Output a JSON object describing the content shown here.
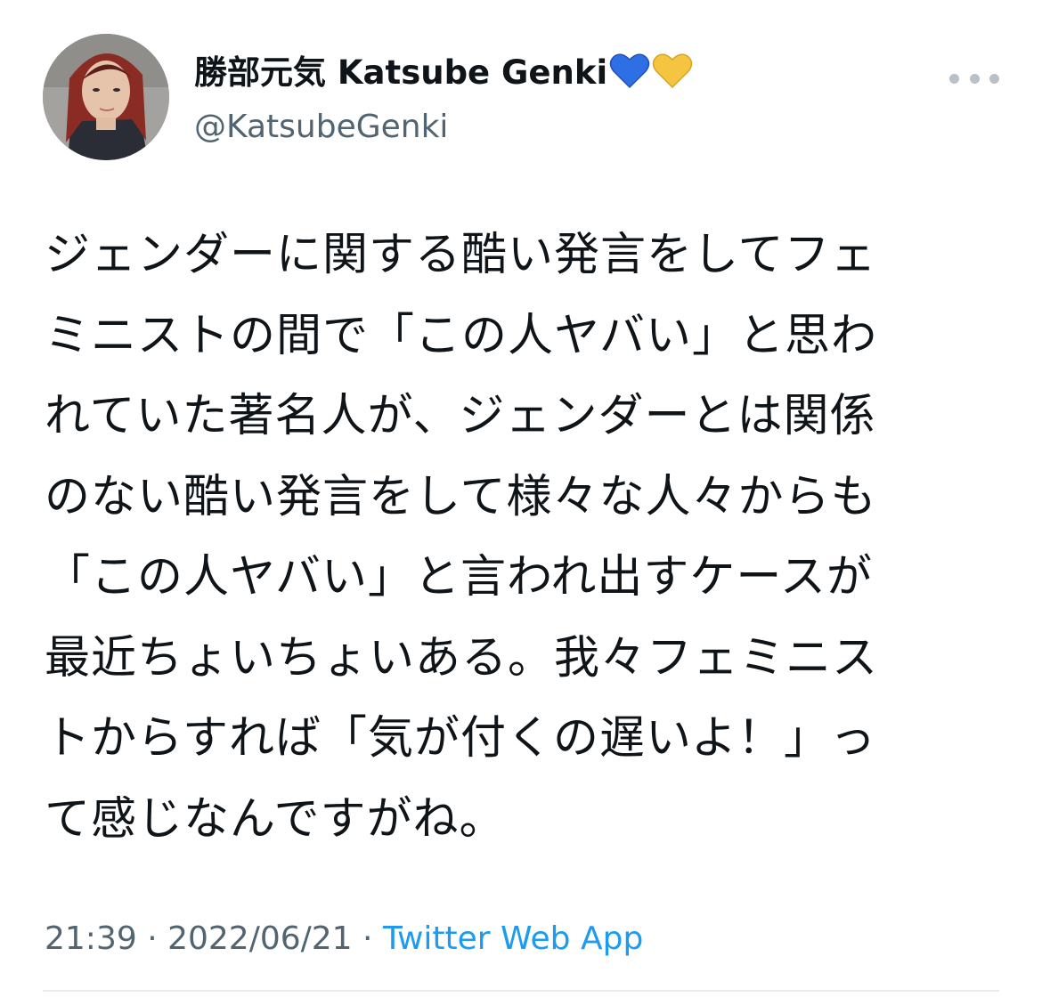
{
  "author": {
    "display_name": "勝部元気 Katsube Genki",
    "handle": "@KatsubeGenki",
    "hearts": [
      "blue-heart-icon",
      "yellow-heart-icon"
    ],
    "heart_colors": {
      "blue": "#2f6fe6",
      "yellow": "#f5c542"
    }
  },
  "tweet": {
    "lines": [
      "ジェンダーに関する酷い発言をしてフェ",
      "ミニストの間で「この人ヤバい」と思わ",
      "れていた著名人が、ジェンダーとは関係",
      "のない酷い発言をして様々な人々からも",
      "「この人ヤバい」と言われ出すケースが",
      "最近ちょいちょいある。我々フェミニス",
      "トからすれば「気が付くの遅いよ！」っ",
      "て感じなんですがね。"
    ]
  },
  "meta": {
    "time": "21:39",
    "separator": " · ",
    "date": "2022/06/21",
    "separator2": " · ",
    "source": "Twitter Web App"
  },
  "icons": {
    "more": "more-horizontal-icon"
  },
  "colors": {
    "text": "#0f1419",
    "secondary": "#536471",
    "link": "#1d9bf0"
  }
}
